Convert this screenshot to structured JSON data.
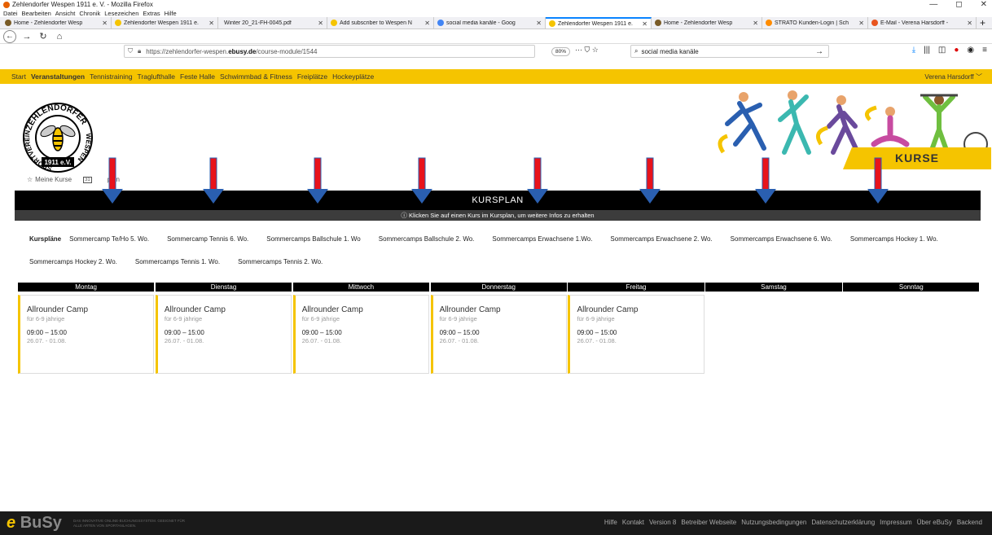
{
  "window": {
    "title": "Zehlendorfer Wespen 1911 e. V. - Mozilla Firefox",
    "controls": {
      "minimize": "—",
      "maximize": "◻",
      "close": "✕"
    }
  },
  "menu": [
    "Datei",
    "Bearbeiten",
    "Ansicht",
    "Chronik",
    "Lesezeichen",
    "Extras",
    "Hilfe"
  ],
  "tabs": [
    {
      "label": "Home - Zehlendorfer Wesp",
      "icon_color": "#7a5c28",
      "active": false
    },
    {
      "label": "Zehlendorfer Wespen 1911 e.",
      "icon_color": "#f5c400",
      "active": false
    },
    {
      "label": "Winter 20_21-FH-0045.pdf",
      "icon_color": "",
      "active": false
    },
    {
      "label": "Add subscriber to Wespen N",
      "icon_color": "#f5c400",
      "active": false
    },
    {
      "label": "social media kanäle - Goog",
      "icon_color": "#4285f4",
      "active": false
    },
    {
      "label": "Zehlendorfer Wespen 1911 e.",
      "icon_color": "#f5c400",
      "active": true
    },
    {
      "label": "Home - Zehlendorfer Wesp",
      "icon_color": "#7a5c28",
      "active": false
    },
    {
      "label": "STRATO Kunden-Login | Sch",
      "icon_color": "#ff8c00",
      "active": false
    },
    {
      "label": "E-Mail - Verena Harsdorff -",
      "icon_color": "#e8541e",
      "active": false
    }
  ],
  "new_tab": "+",
  "address": {
    "url_prefix": "https://zehlendorfer-wespen.",
    "url_domain": "ebusy.de",
    "url_path": "/course-module/1544",
    "zoom": "80%",
    "more": "···"
  },
  "search": {
    "value": "social media kanäle"
  },
  "site_nav": {
    "items": [
      "Start",
      "Veranstaltungen",
      "Tennistraining",
      "Traglufthalle",
      "Feste Halle",
      "Schwimmbad & Fitness",
      "Freiplätze",
      "Hockeyplätze"
    ],
    "user": "Verena Harsdorff"
  },
  "logo": {
    "top_text": "ZEHLENDORFER",
    "left_text": "SPORTVEREIN",
    "right_text": "WESPEN",
    "bottom_text": "1911 e.V."
  },
  "header_badge": "KURSE",
  "subnav": {
    "my_courses": "Meine Kurse",
    "plan": "plan",
    "calendar_day": "31"
  },
  "kursplan": {
    "title": "KURSPLAN",
    "info": "Klicken Sie auf einen Kurs im Kursplan, um weitere Infos zu erhalten"
  },
  "plans": {
    "label": "Kurspläne",
    "row1": [
      "Sommercamp Te/Ho 5. Wo.",
      "Sommercamp Tennis 6. Wo.",
      "Sommercamps Ballschule 1. Wo",
      "Sommercamps Ballschule 2. Wo.",
      "Sommercamps Erwachsene 1.Wo.",
      "Sommercamps Erwachsene 2. Wo.",
      "Sommercamps Erwachsene 6. Wo.",
      "Sommercamps Hockey 1. Wo."
    ],
    "row2": [
      "Sommercamps Hockey 2. Wo.",
      "Sommercamps Tennis 1. Wo.",
      "Sommercamps Tennis 2. Wo."
    ]
  },
  "days": [
    {
      "name": "Montag",
      "course": {
        "name": "Allrounder Camp",
        "age": "für 6-9 jährige",
        "time": "09:00 – 15:00",
        "date": "26.07. - 01.08."
      }
    },
    {
      "name": "Dienstag",
      "course": {
        "name": "Allrounder Camp",
        "age": "für 6-9 jährige",
        "time": "09:00 – 15:00",
        "date": "26.07. - 01.08."
      }
    },
    {
      "name": "Mittwoch",
      "course": {
        "name": "Allrounder Camp",
        "age": "für 6-9 jährige",
        "time": "09:00 – 15:00",
        "date": "26.07. - 01.08."
      }
    },
    {
      "name": "Donnerstag",
      "course": {
        "name": "Allrounder Camp",
        "age": "für 6-9 jährige",
        "time": "09:00 – 15:00",
        "date": "26.07. - 01.08."
      }
    },
    {
      "name": "Freitag",
      "course": {
        "name": "Allrounder Camp",
        "age": "für 6-9 jährige",
        "time": "09:00 – 15:00",
        "date": "26.07. - 01.08."
      }
    },
    {
      "name": "Samstag",
      "course": null
    },
    {
      "name": "Sonntag",
      "course": null
    }
  ],
  "footer": {
    "brand_e": "e",
    "brand_busy": "BuSy",
    "tagline": "DAS INNOVATIVE ONLINE-BUCHUNGSSYSTEM. GEEIGNET FÜR ALLE ARTEN VON SPORTANLAGEN.",
    "links": [
      "Hilfe",
      "Kontakt",
      "Version 8",
      "Betreiber Webseite",
      "Nutzungsbedingungen",
      "Datenschutzerklärung",
      "Impressum",
      "Über eBuSy",
      "Backend"
    ]
  },
  "colors": {
    "brand_yellow": "#f5c400",
    "arrow_red": "#e8131b",
    "arrow_blue": "#2a5fb0",
    "black": "#000000"
  }
}
